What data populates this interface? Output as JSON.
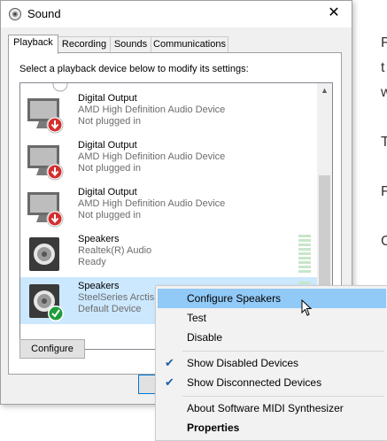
{
  "background_text": [
    "F",
    "t",
    "w",
    "T",
    "F",
    "C"
  ],
  "window": {
    "title": "Sound"
  },
  "tabs": [
    {
      "label": "Playback",
      "active": true
    },
    {
      "label": "Recording",
      "active": false
    },
    {
      "label": "Sounds",
      "active": false
    },
    {
      "label": "Communications",
      "active": false
    }
  ],
  "instruction": "Select a playback device below to modify its settings:",
  "devices": [
    {
      "name": "Digital Output",
      "driver": "AMD High Definition Audio Device",
      "status": "Not plugged in",
      "icon": "monitor-icon",
      "badge": "red-down-arrow"
    },
    {
      "name": "Digital Output",
      "driver": "AMD High Definition Audio Device",
      "status": "Not plugged in",
      "icon": "monitor-icon",
      "badge": "red-down-arrow"
    },
    {
      "name": "Digital Output",
      "driver": "AMD High Definition Audio Device",
      "status": "Not plugged in",
      "icon": "monitor-icon",
      "badge": "red-down-arrow"
    },
    {
      "name": "Speakers",
      "driver": "Realtek(R) Audio",
      "status": "Ready",
      "icon": "speaker-icon"
    },
    {
      "name": "Speakers",
      "driver": "SteelSeries Arctis",
      "status": "Default Device",
      "icon": "speaker-icon",
      "badge": "green-check",
      "selected": true
    }
  ],
  "buttons": {
    "configure": "Configure"
  },
  "context_menu": {
    "items": [
      {
        "label": "Configure Speakers",
        "highlighted": true
      },
      {
        "label": "Test"
      },
      {
        "label": "Disable"
      },
      {
        "label": "Show Disabled Devices",
        "checked": true
      },
      {
        "label": "Show Disconnected Devices",
        "checked": true
      },
      {
        "label": "About Software MIDI Synthesizer"
      },
      {
        "label": "Properties",
        "bold": true
      }
    ]
  },
  "colors": {
    "selection": "#cce8ff",
    "menu_highlight": "#91c9f7",
    "check": "#1e5fa8",
    "error_badge": "#d32f2f",
    "ok_badge": "#1e9e3a"
  }
}
